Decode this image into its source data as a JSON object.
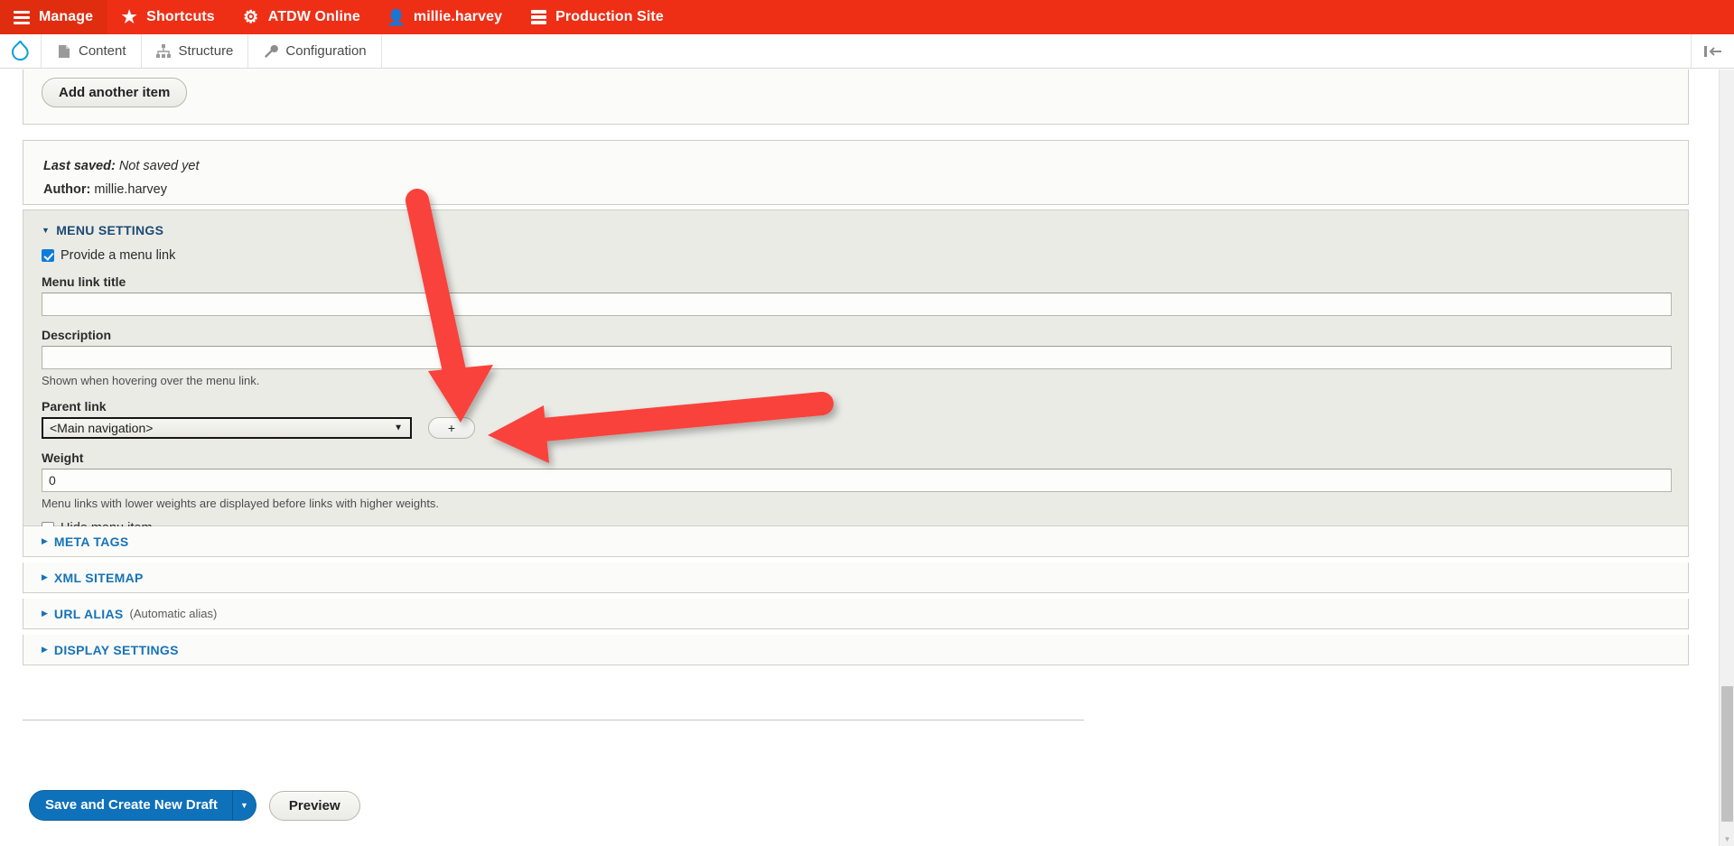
{
  "toolbar": {
    "items": [
      {
        "label": "Manage",
        "icon": "hamburger-icon",
        "active": true
      },
      {
        "label": "Shortcuts",
        "icon": "star-icon",
        "active": false
      },
      {
        "label": "ATDW Online",
        "icon": "gear-icon",
        "active": false
      },
      {
        "label": "millie.harvey",
        "icon": "user-icon",
        "active": false
      },
      {
        "label": "Production Site",
        "icon": "server-icon",
        "active": false
      }
    ]
  },
  "tabs": {
    "logo_icon": "drupal-logo-icon",
    "items": [
      {
        "label": "Content",
        "icon": "document-icon"
      },
      {
        "label": "Structure",
        "icon": "sitemap-icon"
      },
      {
        "label": "Configuration",
        "icon": "wrench-icon"
      }
    ],
    "orientation_icon": "toolbar-orientation-icon"
  },
  "form": {
    "add_another_item": "Add another item",
    "meta": {
      "last_saved_label": "Last saved:",
      "last_saved_value": "Not saved yet",
      "author_label": "Author:",
      "author_value": "millie.harvey"
    },
    "menu_settings": {
      "title": "MENU SETTINGS",
      "provide_menu_link_label": "Provide a menu link",
      "provide_menu_link_checked": true,
      "menu_link_title_label": "Menu link title",
      "menu_link_title_value": "",
      "description_label": "Description",
      "description_value": "",
      "description_help": "Shown when hovering over the menu link.",
      "parent_link_label": "Parent link",
      "parent_link_value": "<Main navigation>",
      "parent_link_options": [
        "<Main navigation>"
      ],
      "add_parent_button": "+",
      "weight_label": "Weight",
      "weight_value": "0",
      "weight_help": "Menu links with lower weights are displayed before links with higher weights.",
      "hide_menu_item_label": "Hide menu item",
      "hide_menu_item_checked": false
    },
    "collapsed_sections": [
      {
        "title": "META TAGS",
        "sub": ""
      },
      {
        "title": "XML SITEMAP",
        "sub": ""
      },
      {
        "title": "URL ALIAS",
        "sub": "(Automatic alias)"
      },
      {
        "title": "DISPLAY SETTINGS",
        "sub": ""
      }
    ],
    "actions": {
      "save_label": "Save and Create New Draft",
      "save_dropdown_icon": "chevron-down-icon",
      "preview_label": "Preview"
    }
  },
  "annotations": {
    "color": "#f9423a",
    "arrows": [
      {
        "name": "arrow-down-to-add-parent",
        "direction": "down"
      },
      {
        "name": "arrow-left-to-add-parent",
        "direction": "left"
      }
    ]
  },
  "colors": {
    "toolbar_red": "#ee2f16",
    "primary_blue": "#1071bb",
    "fieldset_link_blue": "#1573b9",
    "fieldset_title_navy": "#1b4b73",
    "annotation_red": "#f9423a"
  }
}
